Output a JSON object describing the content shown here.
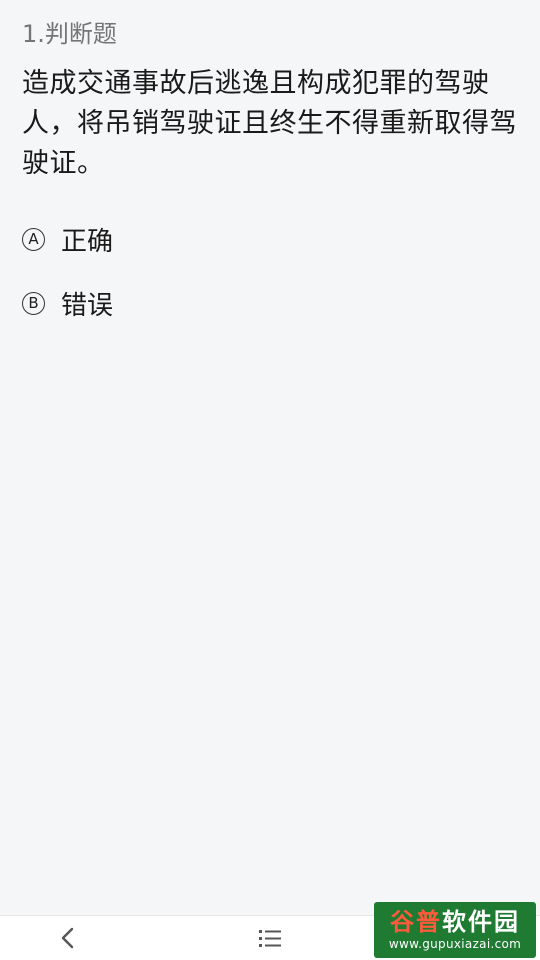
{
  "question": {
    "type_label": "1.判断题",
    "text": "造成交通事故后逃逸且构成犯罪的驾驶人，将吊销驾驶证且终生不得重新取得驾驶证。",
    "options": [
      {
        "mark": "A",
        "label": "正确"
      },
      {
        "mark": "B",
        "label": "错误"
      }
    ]
  },
  "bottom_nav": {
    "back_icon": "chevron-left-icon",
    "list_icon": "list-icon",
    "next_icon": "chevron-right-icon"
  },
  "watermark": {
    "title_part1": "谷普",
    "title_part2": "软件园",
    "url": "www.gupuxiazai.com"
  }
}
